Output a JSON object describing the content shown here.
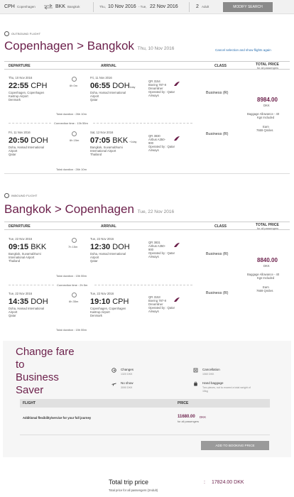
{
  "search_bar": {
    "origin_code": "CPH",
    "origin_city": "Copenhagen",
    "destination_code": "BKK",
    "destination_city": "Bangkok",
    "dates_prefix": "Thu,",
    "date_out": "10 Nov 2016",
    "dates_mid": "- Tue,",
    "date_back": "22 Nov 2016",
    "pax_count": "2",
    "pax_label": "Adult",
    "modify_label": "MODIFY SEARCH"
  },
  "outbound": {
    "section_label": "OUTBOUND FLIGHT",
    "route": "Copenhagen > Bangkok",
    "route_date": "Thu, 10 Nov 2016",
    "cancel_link": "Cancel selection and show flights again",
    "headers": {
      "departure": "DEPARTURE",
      "arrival": "ARRIVAL",
      "class": "CLASS",
      "total_price": "TOTAL PRICE",
      "total_price_sub": "for all passengers"
    },
    "segments": [
      {
        "dep_date": "Thu, 10 Nov 2016",
        "dep_time": "22:55",
        "dep_code": "CPH",
        "dep_place": [
          "Copenhagen, Copenhagen",
          "Kastrup Airport",
          "Denmark"
        ],
        "duration": "6h 0m",
        "arr_date": "Fri, 11 Nov 2016",
        "arr_time": "06:55",
        "arr_code": "DOH",
        "arr_plus": "+1day",
        "arr_place": [
          "Doha, Hamad International",
          "Airport",
          "Qatar"
        ],
        "flight_info": [
          "QR 3154",
          "Boeing 787-8",
          "Dreamliner",
          "Operated by : Qatar",
          "Airways"
        ],
        "class": "Business (R)"
      },
      {
        "dep_date": "Fri, 11 Nov 2016",
        "dep_time": "20:50",
        "dep_code": "DOH",
        "dep_place": [
          "Doha, Hamad International",
          "Airport",
          "Qatar"
        ],
        "duration": "6h 15m",
        "arr_date": "Sat, 12 Nov 2016",
        "arr_time": "07:05",
        "arr_code": "BKK",
        "arr_plus": "+1day",
        "arr_place": [
          "Bangkok, Suvarnabhumi",
          "International Airport",
          "Thailand"
        ],
        "flight_info": [
          "QR 3830",
          "Airbus A350-",
          "900",
          "Operated by : Qatar",
          "Airways"
        ],
        "class": "Business (R)"
      }
    ],
    "total_duration_1": "Total duration : 26h 10m",
    "connection": "Connection time : 13h 55m",
    "total_duration_2": "Total duration : 26h 10m",
    "price": "8984.00",
    "currency": "DKK",
    "baggage": [
      "Baggage Allowance - 40",
      "Kgs Included"
    ],
    "earn": [
      "Earn",
      "7669 Qmiles"
    ]
  },
  "inbound": {
    "section_label": "INBOUND FLIGHT",
    "route": "Bangkok > Copenhagen",
    "route_date": "Tue, 22 Nov 2016",
    "headers": {
      "departure": "DEPARTURE",
      "arrival": "ARRIVAL",
      "class": "CLASS",
      "total_price": "TOTAL PRICE",
      "total_price_sub": "for all passengers"
    },
    "segments": [
      {
        "dep_date": "Tue, 22 Nov 2016",
        "dep_time": "09:15",
        "dep_code": "BKK",
        "dep_place": [
          "Bangkok, Suvarnabhumi",
          "International Airport",
          "Thailand"
        ],
        "duration": "7h 15m",
        "arr_date": "Tue, 22 Nov 2016",
        "arr_time": "12:30",
        "arr_code": "DOH",
        "arr_place": [
          "Doha, Hamad International",
          "Airport",
          "Qatar"
        ],
        "flight_info": [
          "QR 3831",
          "Airbus A350-",
          "900",
          "Operated by : Qatar",
          "Airways"
        ],
        "class": "Business (R)"
      },
      {
        "dep_date": "Tue, 22 Nov 2016",
        "dep_time": "14:35",
        "dep_code": "DOH",
        "dep_place": [
          "Doha, Hamad International",
          "Airport",
          "Qatar"
        ],
        "duration": "6h 35m",
        "arr_date": "Tue, 22 Nov 2016",
        "arr_time": "19:10",
        "arr_code": "CPH",
        "arr_place": [
          "Copenhagen, Copenhagen",
          "Kastrup Airport",
          "Denmark"
        ],
        "flight_info": [
          "QR 3153",
          "Boeing 787-8",
          "Dreamliner",
          "Operated by : Qatar",
          "Airways"
        ],
        "class": "Business (R)"
      }
    ],
    "total_duration_1": "Total duration : 15h 55m",
    "connection": "Connection time : 2h 5m",
    "total_duration_2": "Total duration : 15h 55m",
    "price": "8840.00",
    "currency": "DKK",
    "baggage": [
      "Baggage Allowance - 40",
      "Kgs Included"
    ],
    "earn": [
      "Earn",
      "7669 Qmiles"
    ]
  },
  "fare_change": {
    "title_lines": [
      "Change fare",
      "to",
      "Business",
      "Saver"
    ],
    "changes_label": "Changes",
    "changes_sub": "1320 DKK",
    "noshow_label": "No show",
    "noshow_sub": "3090 DKK",
    "cancellation_label": "Cancellation",
    "cancellation_sub": "1060 DKK",
    "hand_baggage_label": "Hand baggage",
    "hand_baggage_sub": "Two pieces, not to exceed a total weight of",
    "hand_baggage_sub2": "15kg",
    "table_flight": "FLIGHT",
    "table_price": "PRICE",
    "row_desc": "Additional flexibility/service for your full journey",
    "row_price": "11680.00",
    "row_currency": "DKK",
    "row_price_sub": "for all passengers",
    "add_button": "ADD TO BOOKING PRICE"
  },
  "total": {
    "label": "Total trip price",
    "sub": "Total price for all passengers (2Adult)",
    "colon": ":",
    "amount": "17824.00 DKK"
  },
  "colors": {
    "brand": "#6b1f4a",
    "link": "#2a6fb0",
    "button_gray": "#8a8a8a"
  }
}
